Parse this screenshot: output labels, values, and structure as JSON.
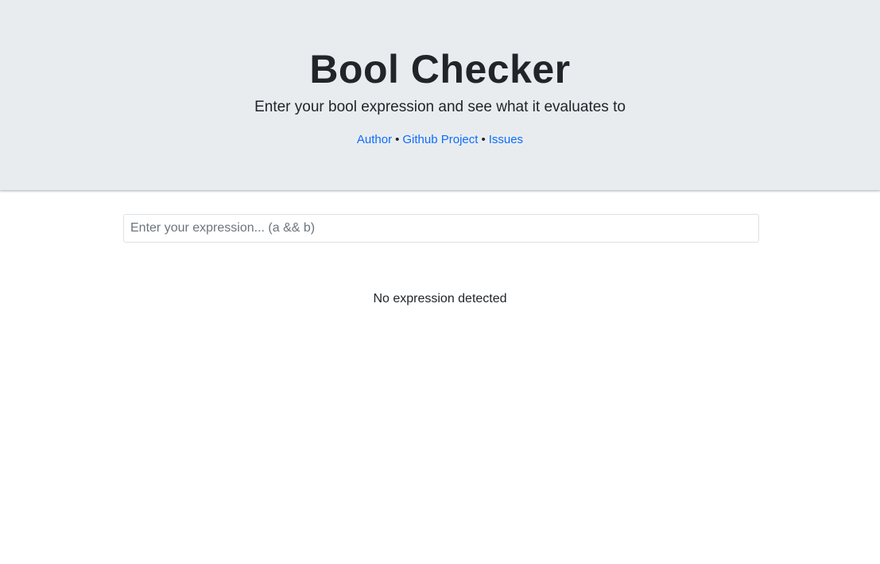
{
  "header": {
    "title": "Bool Checker",
    "subtitle": "Enter your bool expression and see what it evaluates to",
    "links": {
      "author": "Author",
      "github": "Github Project",
      "issues": "Issues",
      "separator": "•"
    }
  },
  "main": {
    "input": {
      "value": "",
      "placeholder": "Enter your expression... (a && b)"
    },
    "result_text": "No expression detected"
  },
  "colors": {
    "hero_background": "#e9ecef",
    "link": "#0d6efd",
    "text": "#212529"
  }
}
